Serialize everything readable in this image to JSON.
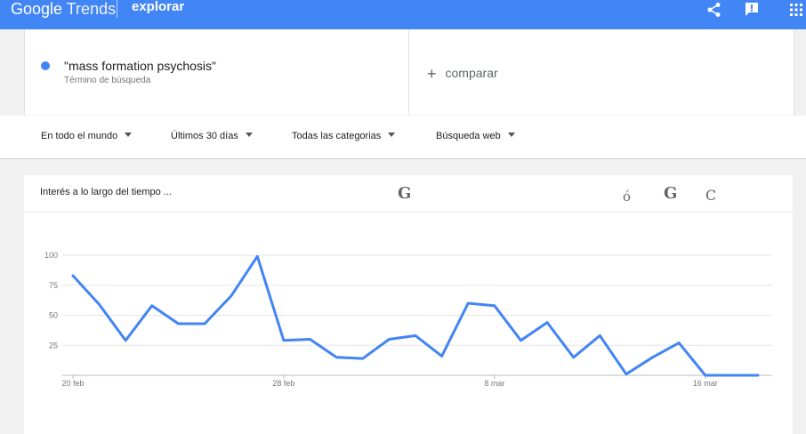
{
  "header": {
    "logo_google": "Google",
    "logo_trends": "Trends",
    "section": "explorar",
    "icons": [
      "share-icon",
      "feedback-icon",
      "apps-grid-icon"
    ]
  },
  "search": {
    "term": "\"mass formation psychosis\"",
    "term_type": "Término de búsqueda",
    "term_color": "#4285f4",
    "compare_label": "comparar"
  },
  "filters": {
    "region": "En todo el mundo",
    "period": "Últimos 30 días",
    "category": "Todas las categorias",
    "search_type": "Búsqueda web"
  },
  "chart_header": {
    "title": "Interés a lo largo del tiempo ...",
    "glyphs": [
      "G",
      "ó",
      "G",
      "C"
    ]
  },
  "chart_data": {
    "type": "line",
    "title": "Interés a lo largo del tiempo",
    "xlabel": "",
    "ylabel": "",
    "ylim": [
      0,
      100
    ],
    "yticks": [
      25,
      50,
      75,
      100
    ],
    "grid": true,
    "legend": "none",
    "x_tick_labels": [
      {
        "index": 0,
        "label": "20 feb"
      },
      {
        "index": 8,
        "label": "28 feb"
      },
      {
        "index": 16,
        "label": "8 mar"
      },
      {
        "index": 24,
        "label": "16 mar"
      }
    ],
    "x": [
      "20 feb",
      "21 feb",
      "22 feb",
      "23 feb",
      "24 feb",
      "25 feb",
      "26 feb",
      "27 feb",
      "28 feb",
      "1 mar",
      "2 mar",
      "3 mar",
      "4 mar",
      "5 mar",
      "6 mar",
      "7 mar",
      "8 mar",
      "9 mar",
      "10 mar",
      "11 mar",
      "12 mar",
      "13 mar",
      "14 mar",
      "15 mar",
      "16 mar",
      "17 mar",
      "18 mar"
    ],
    "series": [
      {
        "color": "#4285f4",
        "values": [
          83,
          59,
          29,
          58,
          43,
          43,
          66,
          99,
          29,
          30,
          15,
          14,
          30,
          33,
          16,
          60,
          58,
          29,
          44,
          15,
          33,
          1,
          15,
          27,
          0,
          0,
          0
        ]
      }
    ]
  }
}
